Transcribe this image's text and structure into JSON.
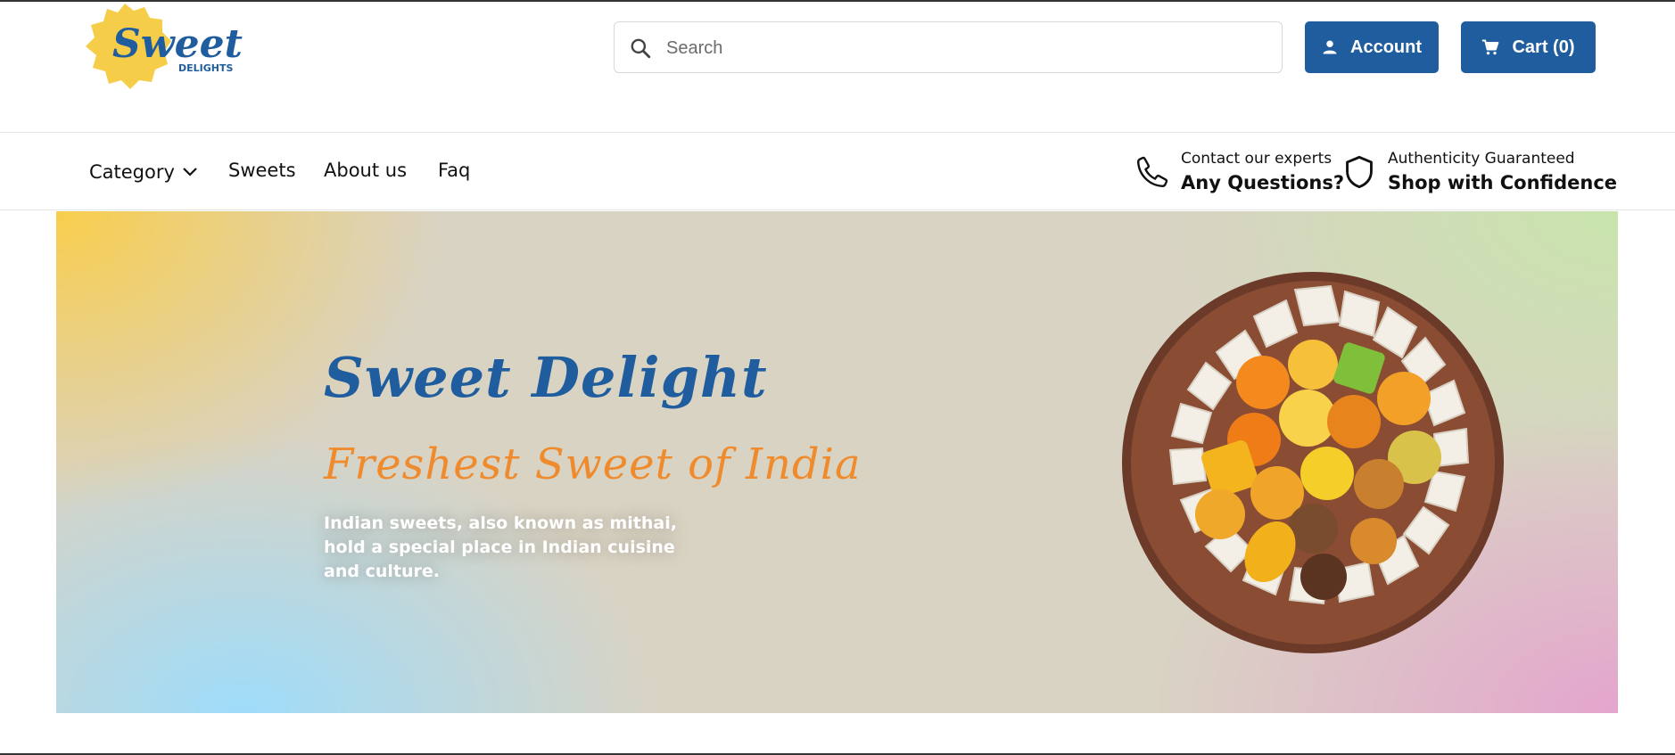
{
  "header": {
    "logo": {
      "word": "Sweet",
      "tagline": "DELIGHTS"
    },
    "search": {
      "placeholder": "Search",
      "value": ""
    },
    "account_label": "Account",
    "cart_label": "Cart (0)"
  },
  "nav": {
    "items": [
      {
        "label": "Category",
        "has_dropdown": true
      },
      {
        "label": "Sweets"
      },
      {
        "label": "About us"
      },
      {
        "label": "Faq"
      }
    ],
    "contact": {
      "small": "Contact our experts",
      "big": "Any Questions?"
    },
    "authenticity": {
      "small": "Authenticity Guaranteed",
      "big": "Shop with Confidence"
    }
  },
  "hero": {
    "title": "Sweet Delight",
    "subtitle": "Freshest Sweet of India",
    "description": "Indian sweets, also known as mithai, hold a special place in Indian cuisine and culture."
  },
  "colors": {
    "brand_blue": "#1f5d9e",
    "accent_orange": "#ef8b2c",
    "logo_yellow": "#f6cd48"
  },
  "icons": [
    "search-icon",
    "user-icon",
    "cart-icon",
    "chevron-down-icon",
    "phone-icon",
    "shield-icon"
  ]
}
